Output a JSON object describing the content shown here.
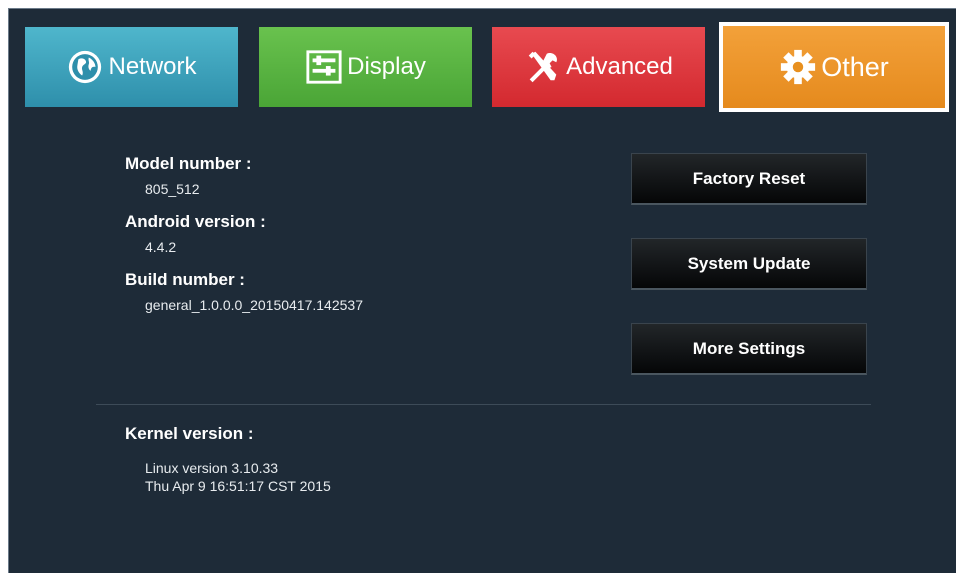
{
  "tabs": {
    "network": {
      "label": "Network",
      "icon": "globe-icon"
    },
    "display": {
      "label": "Display",
      "icon": "display-settings-icon"
    },
    "advanced": {
      "label": "Advanced",
      "icon": "tools-icon"
    },
    "other": {
      "label": "Other",
      "icon": "gear-icon",
      "selected": true
    }
  },
  "info": {
    "model_label": "Model number :",
    "model_value": "805_512",
    "android_label": "Android version :",
    "android_value": "4.4.2",
    "build_label": "Build number :",
    "build_value": "general_1.0.0.0_20150417.142537"
  },
  "buttons": {
    "factory_reset": "Factory Reset",
    "system_update": "System Update",
    "more_settings": "More Settings"
  },
  "kernel": {
    "label": "Kernel version :",
    "line1": "Linux version 3.10.33",
    "line2": "Thu Apr 9 16:51:17 CST 2015"
  },
  "colors": {
    "background": "#1e2b38",
    "network": "#3aa2bd",
    "display": "#5ab442",
    "advanced": "#de3a40",
    "other": "#ec962b"
  }
}
